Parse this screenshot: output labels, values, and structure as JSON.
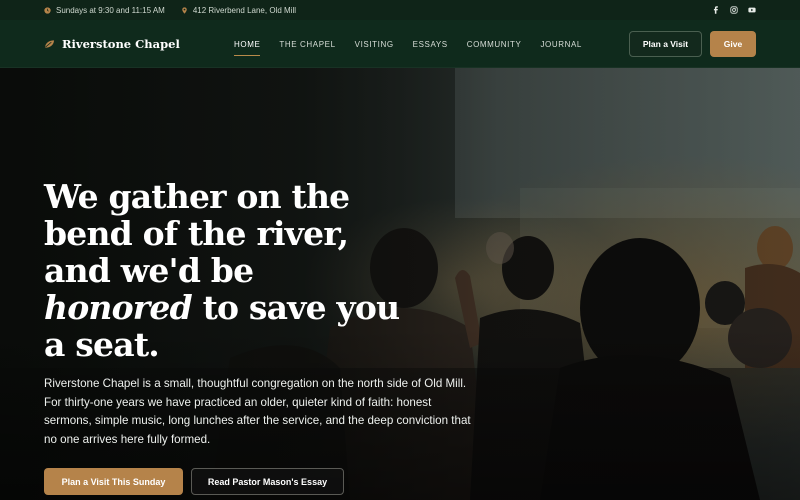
{
  "topbar": {
    "service_times": "Sundays at 9:30 and 11:15 AM",
    "address": "412 Riverbend Lane, Old Mill",
    "social": [
      "facebook-icon",
      "instagram-icon",
      "youtube-icon"
    ]
  },
  "nav": {
    "brand": "Riverstone Chapel",
    "items": [
      {
        "label": "HOME",
        "active": true
      },
      {
        "label": "THE CHAPEL"
      },
      {
        "label": "VISITING"
      },
      {
        "label": "ESSAYS"
      },
      {
        "label": "COMMUNITY"
      },
      {
        "label": "JOURNAL"
      }
    ],
    "plan_visit": "Plan a Visit",
    "give": "Give"
  },
  "hero": {
    "headline_line1": "We gather on the",
    "headline_line2": "bend of the river,",
    "headline_line3": "and we'd be",
    "headline_em": "honored",
    "headline_line4_rest": " to save you",
    "headline_line5": "a seat.",
    "lede": "Riverstone Chapel is a small, thoughtful congregation on the north side of Old Mill. For thirty-one years we have practiced an older, quieter kind of faith: honest sermons, simple music, long lunches after the service, and the deep conviction that no one arrives here fully formed.",
    "cta_primary": "Plan a Visit This Sunday",
    "cta_secondary": "Read Pastor Mason's Essay"
  },
  "colors": {
    "accent": "#b5834a",
    "nav_bg": "#0f2a1c",
    "topbar_bg": "#0f2418"
  }
}
